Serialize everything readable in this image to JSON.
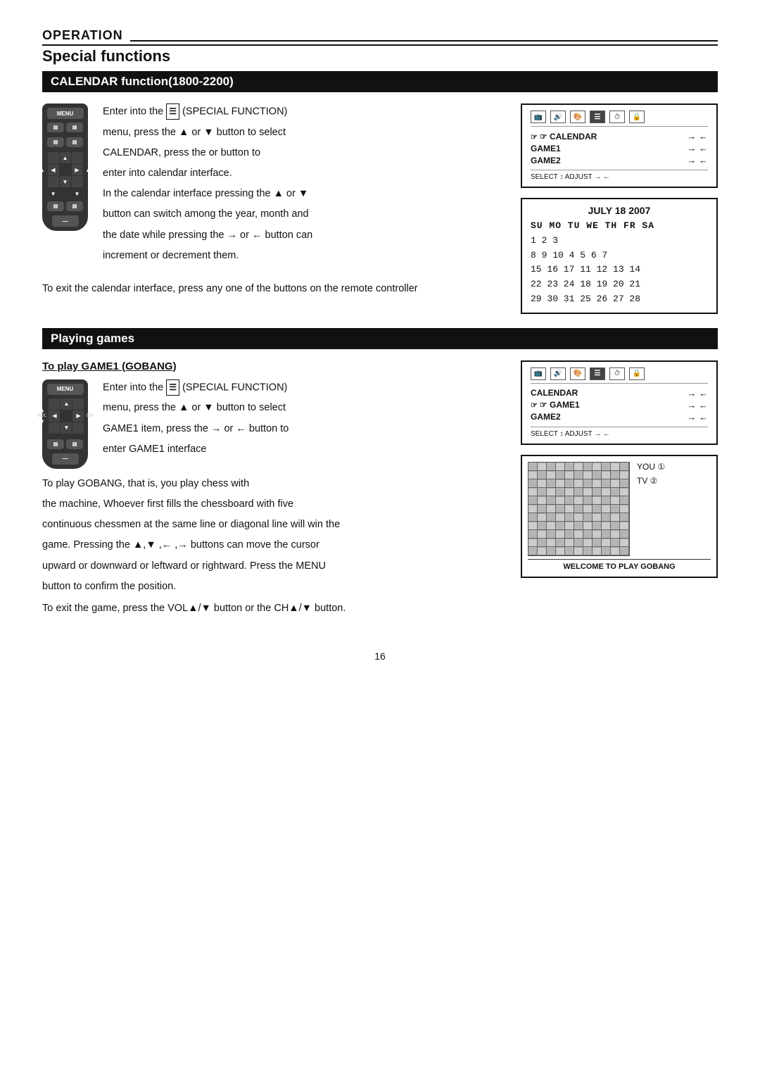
{
  "header": {
    "operation_label": "OPERATION",
    "special_functions_label": "Special functions"
  },
  "calendar_section": {
    "title": "CALENDAR function(1800-2200)",
    "instruction1": "Enter into the",
    "instruction1b": "(SPECIAL FUNCTION)",
    "instruction2": "menu, press the ▲ or ▼ button to select",
    "instruction3": "CALENDAR, press the  or  button to",
    "instruction4": "enter into calendar interface.",
    "instruction5": "In the calendar interface pressing the ▲ or ▼",
    "instruction6": "button can switch among the year, month and",
    "instruction7": "the date while pressing the → or ← button can",
    "instruction8": "increment or decrement them.",
    "exit_text": "To exit the calendar interface, press any one of the buttons on the remote controller"
  },
  "calendar_ui": {
    "menu_label": "☞ CALENDAR",
    "game1_label": "GAME1",
    "game2_label": "GAME2",
    "arrows": "→ ←",
    "arrows2": "→ ←",
    "select_adjust": "SELECT ↕ ADJUST → ←"
  },
  "calendar_display": {
    "title": "JULY 18 2007",
    "header_row": "SU MO TU WE TH  FR SA",
    "row1": " 1   2   3",
    "row2": " 8   9  10   4   5   6   7",
    "row3": "15  16  17  11  12  13  14",
    "row4": "22  23  24  18  19  20  21",
    "row5": "29  30  31  25  26  27  28"
  },
  "playing_games_section": {
    "title": "Playing games",
    "subtitle": "To  play GAME1 (GOBANG)",
    "instruction1": "Enter into the",
    "instruction1b": "(SPECIAL FUNCTION)",
    "instruction2": "menu, press the ▲ or ▼ button to select",
    "instruction3": "GAME1 item, press the → or ← button to",
    "instruction4": "enter GAME1 interface",
    "gobang_text1": "To play GOBANG, that is, you play chess with",
    "gobang_text2": "the machine, Whoever first fills the chessboard with five",
    "gobang_text3": "continuous chessmen at the same line or diagonal line will win the",
    "gobang_text4": "game. Pressing the ▲,▼ ,← ,→  buttons can move the cursor",
    "gobang_text5": "upward or downward or leftward or rightward. Press the MENU",
    "gobang_text6": "button to confirm the position.",
    "exit_text": "To exit the game, press the VOL▲/▼ button or the CH▲/▼ button."
  },
  "games_ui": {
    "calendar_label": "CALENDAR",
    "game1_label": "☞ GAME1",
    "game2_label": "GAME2",
    "arrows": "→ ←",
    "arrows2": "→ ←",
    "select_adjust": "SELECT ↕ ADJUST → ←"
  },
  "gobang_board": {
    "you_label": "YOU ①",
    "tv_label": "TV ②",
    "welcome": "WELCOME TO PLAY GOBANG"
  },
  "page_number": "16"
}
